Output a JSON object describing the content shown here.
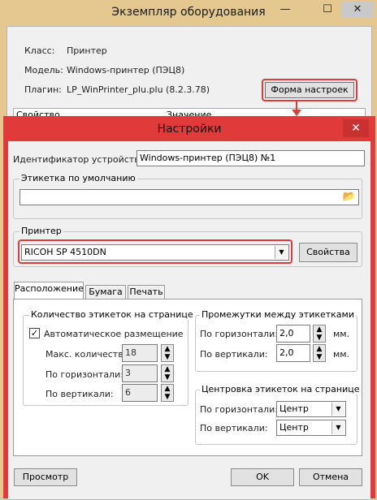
{
  "back_window": {
    "title": "Экземпляр оборудования",
    "minimize": "—",
    "maximize": "☐",
    "close": "✕",
    "class_label": "Класс:",
    "class_value": "Принтер",
    "model_label": "Модель:",
    "model_value": "Windows-принтер (ПЭЦ8)",
    "plugin_label": "Плагин:",
    "plugin_value": "LP_WinPrinter_plu.plu (8.2.3.78)",
    "settings_form_button": "Форма настроек",
    "col_property": "Свойство",
    "col_value": "Значение"
  },
  "dialog": {
    "title": "Настройки",
    "close": "✕",
    "device_id_label": "Идентификатор устройства:",
    "device_id_value": "Windows-принтер (ПЭЦ8) №1",
    "default_label_group": "Этикетка по умолчанию",
    "default_label_value": "",
    "printer_group": "Принтер",
    "printer_value": "RICOH SP 4510DN",
    "properties_button": "Свойства",
    "tabs": [
      "Расположение",
      "Бумага",
      "Печать"
    ],
    "count_group": "Количество этикеток на странице",
    "auto_placement": "Автоматическое размещение",
    "max_count_label": "Макс. количество:",
    "max_count_value": "18",
    "count_horizontal_label": "По горизонтали:",
    "count_horizontal_value": "3",
    "count_vertical_label": "По вертикали:",
    "count_vertical_value": "6",
    "gaps_group": "Промежутки между этикетками",
    "gap_horizontal_label": "По горизонтали:",
    "gap_horizontal_value": "2,0",
    "gap_vertical_label": "По вертикали:",
    "gap_vertical_value": "2,0",
    "unit_mm": "мм.",
    "center_group": "Центровка этикеток на странице",
    "center_horizontal_label": "По горизонтали:",
    "center_horizontal_value": "Центр",
    "center_vertical_label": "По вертикали:",
    "center_vertical_value": "Центр",
    "preview_button": "Просмотр",
    "ok_button": "OK",
    "cancel_button": "Отмена"
  }
}
